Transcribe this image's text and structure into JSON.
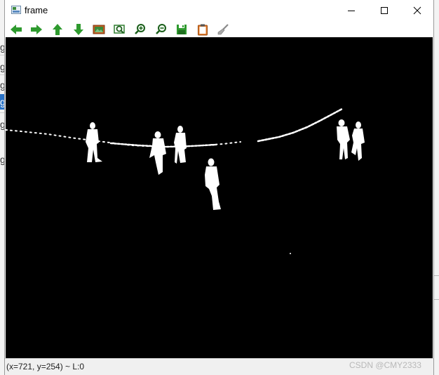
{
  "window": {
    "title": "frame"
  },
  "background_app": {
    "rows": [
      "g",
      "g",
      "g",
      "g",
      "g",
      "g"
    ]
  },
  "toolbar": {
    "buttons": [
      {
        "name": "pan-left-button",
        "icon": "arrow-left-icon"
      },
      {
        "name": "pan-right-button",
        "icon": "arrow-right-icon"
      },
      {
        "name": "pan-up-button",
        "icon": "arrow-up-icon"
      },
      {
        "name": "pan-down-button",
        "icon": "arrow-down-icon"
      },
      {
        "name": "zoom-original-button",
        "icon": "image-icon"
      },
      {
        "name": "zoom-fit-button",
        "icon": "zoom-fit-icon"
      },
      {
        "name": "zoom-in-button",
        "icon": "zoom-in-icon"
      },
      {
        "name": "zoom-out-button",
        "icon": "zoom-out-icon"
      },
      {
        "name": "save-button",
        "icon": "floppy-disk-icon"
      },
      {
        "name": "copy-button",
        "icon": "clipboard-icon"
      },
      {
        "name": "properties-button",
        "icon": "brush-icon"
      }
    ]
  },
  "image": {
    "content": "binary foreground mask: white silhouettes on black"
  },
  "statusbar": {
    "text": "(x=721, y=254) ~ L:0"
  },
  "watermark": {
    "text": "CSDN @CMY2333"
  },
  "colors": {
    "toolbar_green": "#2e9a2e",
    "image_background": "#000000",
    "foreground": "#ffffff"
  }
}
